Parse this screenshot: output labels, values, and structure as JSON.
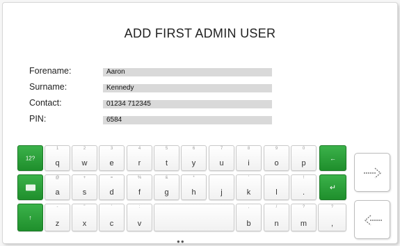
{
  "title": "ADD FIRST ADMIN USER",
  "form": {
    "forename": {
      "label": "Forename:",
      "value": "Aaron"
    },
    "surname": {
      "label": "Surname:",
      "value": "Kennedy"
    },
    "contact": {
      "label": "Contact:",
      "value": "01234 712345"
    },
    "pin": {
      "label": "PIN:",
      "value": "6584"
    }
  },
  "keyboard": {
    "row1": [
      {
        "alt": "1",
        "main": "q"
      },
      {
        "alt": "2",
        "main": "w"
      },
      {
        "alt": "3",
        "main": "e"
      },
      {
        "alt": "4",
        "main": "r"
      },
      {
        "alt": "5",
        "main": "t"
      },
      {
        "alt": "6",
        "main": "y"
      },
      {
        "alt": "7",
        "main": "u"
      },
      {
        "alt": "8",
        "main": "i"
      },
      {
        "alt": "9",
        "main": "o"
      },
      {
        "alt": "0",
        "main": "p"
      }
    ],
    "row2": [
      {
        "alt": "@",
        "main": "a"
      },
      {
        "alt": "+",
        "main": "s"
      },
      {
        "alt": "=",
        "main": "d"
      },
      {
        "alt": "%",
        "main": "f"
      },
      {
        "alt": "&",
        "main": "g"
      },
      {
        "alt": "*",
        "main": "h"
      },
      {
        "alt": "",
        "main": "j"
      },
      {
        "alt": "'",
        "main": "k"
      },
      {
        "alt": "",
        "main": "l"
      },
      {
        "alt": "!",
        "main": "."
      }
    ],
    "row3": [
      {
        "alt": "-",
        "main": "z"
      },
      {
        "alt": "\"",
        "main": "x"
      },
      {
        "alt": "'",
        "main": "c"
      },
      {
        "alt": ":",
        "main": "v"
      },
      {
        "alt": ",",
        "main": "b"
      },
      {
        "alt": "/",
        "main": "n"
      },
      {
        "alt": "?",
        "main": "m"
      },
      {
        "alt": "?",
        "main": ","
      }
    ],
    "mode_label": "12?",
    "backspace_glyph": "←",
    "enter_glyph": "↵",
    "shift_glyph": "↑"
  },
  "nav": {
    "next_icon": "dotted-arrow-right-icon",
    "back_icon": "dotted-arrow-left-icon"
  },
  "pager": "●●"
}
